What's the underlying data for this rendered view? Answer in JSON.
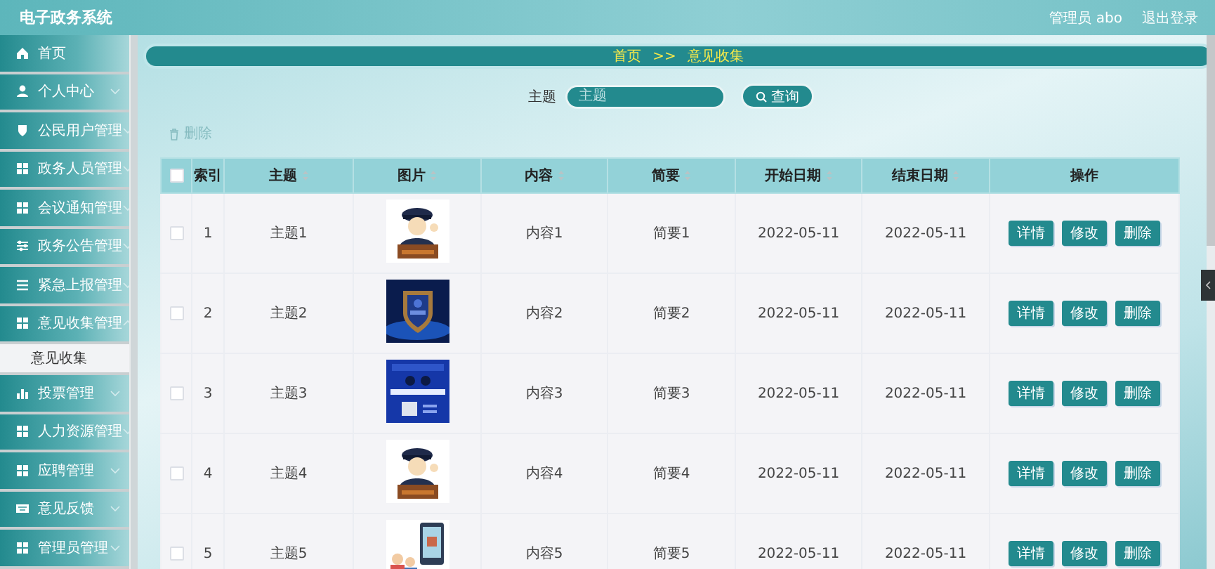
{
  "app": {
    "title": "电子政务系统",
    "user": "管理员 abo",
    "logout": "退出登录"
  },
  "sidebar": {
    "items": [
      {
        "label": "首页"
      },
      {
        "label": "个人中心",
        "expanded": false
      },
      {
        "label": "公民用户管理",
        "expanded": false
      },
      {
        "label": "政务人员管理",
        "expanded": false
      },
      {
        "label": "会议通知管理",
        "expanded": false
      },
      {
        "label": "政务公告管理",
        "expanded": false
      },
      {
        "label": "紧急上报管理",
        "expanded": false
      },
      {
        "label": "意见收集管理",
        "expanded": true,
        "children": [
          {
            "label": "意见收集",
            "selected": true
          }
        ]
      },
      {
        "label": "投票管理",
        "expanded": false
      },
      {
        "label": "人力资源管理",
        "expanded": false
      },
      {
        "label": "应聘管理",
        "expanded": false
      },
      {
        "label": "意见反馈",
        "expanded": false
      },
      {
        "label": "管理员管理",
        "expanded": false
      }
    ]
  },
  "breadcrumb": {
    "items": [
      "首页",
      "意见收集"
    ],
    "separator": ">>"
  },
  "search": {
    "label": "主题",
    "placeholder": "主题",
    "button": "查询"
  },
  "toolbar": {
    "delete_button": "删除",
    "disabled": true
  },
  "table": {
    "select_all": false,
    "columns": [
      {
        "label": "索引",
        "sortable": false
      },
      {
        "label": "主题",
        "sortable": true
      },
      {
        "label": "图片",
        "sortable": true
      },
      {
        "label": "内容",
        "sortable": true
      },
      {
        "label": "简要",
        "sortable": true
      },
      {
        "label": "开始日期",
        "sortable": true
      },
      {
        "label": "结束日期",
        "sortable": true
      },
      {
        "label": "操作",
        "sortable": false
      }
    ],
    "rows": [
      {
        "checked": false,
        "index": "1",
        "subject": "主题1",
        "content": "内容1",
        "summary": "简要1",
        "start": "2022-05-11",
        "end": "2022-05-11",
        "actions": [
          "详情",
          "修改",
          "删除"
        ]
      },
      {
        "checked": false,
        "index": "2",
        "subject": "主题2",
        "content": "内容2",
        "summary": "简要2",
        "start": "2022-05-11",
        "end": "2022-05-11",
        "actions": [
          "详情",
          "修改",
          "删除"
        ]
      },
      {
        "checked": false,
        "index": "3",
        "subject": "主题3",
        "content": "内容3",
        "summary": "简要3",
        "start": "2022-05-11",
        "end": "2022-05-11",
        "actions": [
          "详情",
          "修改",
          "删除"
        ]
      },
      {
        "checked": false,
        "index": "4",
        "subject": "主题4",
        "content": "内容4",
        "summary": "简要4",
        "start": "2022-05-11",
        "end": "2022-05-11",
        "actions": [
          "详情",
          "修改",
          "删除"
        ]
      },
      {
        "checked": false,
        "index": "5",
        "subject": "主题5",
        "content": "内容5",
        "summary": "简要5",
        "start": "2022-05-11",
        "end": "2022-05-11",
        "actions": [
          "详情",
          "修改",
          "删除"
        ]
      }
    ]
  }
}
